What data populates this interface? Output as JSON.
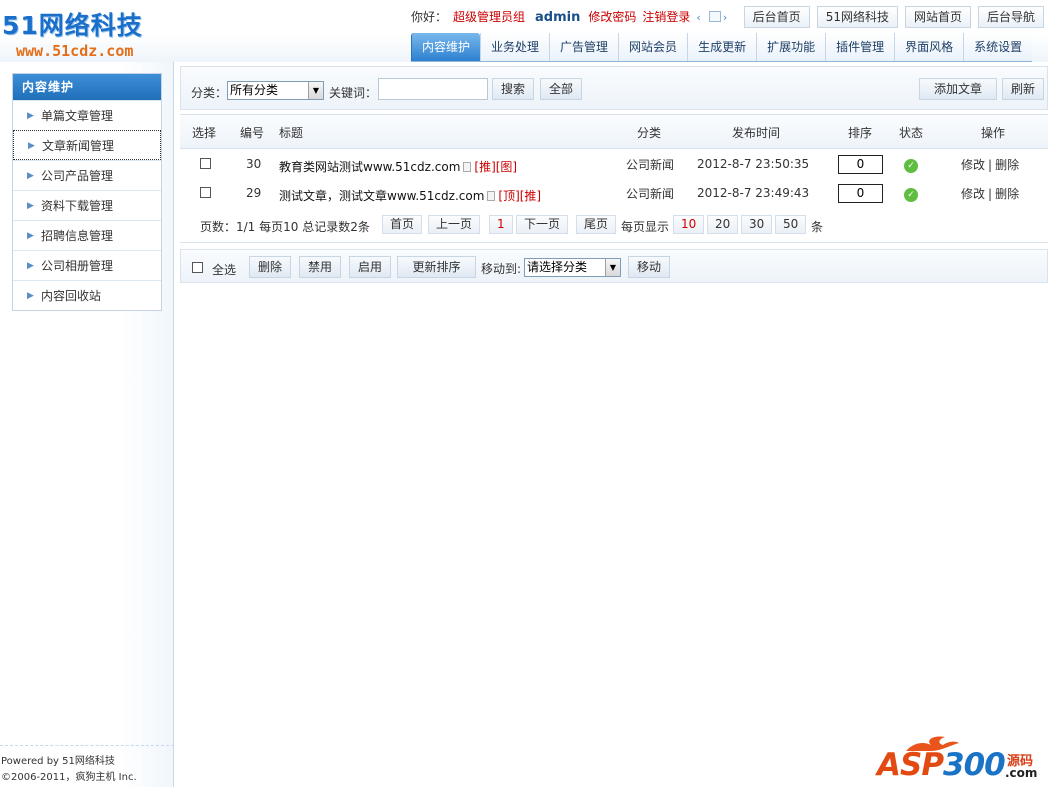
{
  "logo": {
    "brand": "51网络科技",
    "url": "www.51cdz.com"
  },
  "user_bar": {
    "greeting": "你好：",
    "role": "超级管理员组",
    "username": "admin",
    "change_password": "修改密码",
    "logout": "注销登录"
  },
  "top_nav": [
    "后台首页",
    "51网络科技",
    "网站首页",
    "后台导航"
  ],
  "main_tabs": [
    "内容维护",
    "业务处理",
    "广告管理",
    "网站会员",
    "生成更新",
    "扩展功能",
    "插件管理",
    "界面风格",
    "系统设置"
  ],
  "sidebar": {
    "title": "内容维护",
    "items": [
      "单篇文章管理",
      "文章新闻管理",
      "公司产品管理",
      "资料下载管理",
      "招聘信息管理",
      "公司相册管理",
      "内容回收站"
    ],
    "active_index": 1,
    "footer_line1": "Powered by 51网络科技",
    "footer_line2": "©2006-2011，疯狗主机 Inc."
  },
  "toolbar": {
    "category_label": "分类：",
    "category_value": "所有分类",
    "keyword_label": "关键词：",
    "keyword_value": "",
    "search_button": "搜索",
    "all_button": "全部",
    "add_button": "添加文章",
    "refresh_button": "刷新"
  },
  "table": {
    "headers": {
      "select": "选择",
      "id": "编号",
      "title": "标题",
      "category": "分类",
      "published": "发布时间",
      "order": "排序",
      "status": "状态",
      "actions": "操作"
    },
    "rows": [
      {
        "id": "30",
        "title": "教育类网站测试www.51cdz.com",
        "tags": "[推][图]",
        "category": "公司新闻",
        "published": "2012-8-7 23:50:35",
        "order": "0",
        "status": "ok",
        "edit": "修改",
        "delete": "删除"
      },
      {
        "id": "29",
        "title": "测试文章，测试文章www.51cdz.com",
        "tags": "[顶][推]",
        "category": "公司新闻",
        "published": "2012-8-7 23:49:43",
        "order": "0",
        "status": "ok",
        "edit": "修改",
        "delete": "删除"
      }
    ]
  },
  "pager": {
    "summary": "页数：1/1 每页10 总记录数2条",
    "first": "首页",
    "prev": "上一页",
    "current": "1",
    "next": "下一页",
    "last": "尾页",
    "per_page_label": "每页显示",
    "per_page_options": [
      "10",
      "20",
      "30",
      "50"
    ],
    "per_page_selected": "10",
    "unit": "条"
  },
  "bottom_bar": {
    "select_all": "全选",
    "delete": "删除",
    "disable": "禁用",
    "enable": "启用",
    "update_order": "更新排序",
    "move_to_label": "移动到:",
    "move_to_value": "请选择分类",
    "move_button": "移动"
  },
  "watermark": {
    "asp": "ASP",
    "num": "300",
    "yuan": "源码",
    "com": ".com"
  },
  "colors": {
    "accent_blue": "#2c80cf",
    "link_red": "#cc0000",
    "status_green": "#5fbe3f"
  }
}
